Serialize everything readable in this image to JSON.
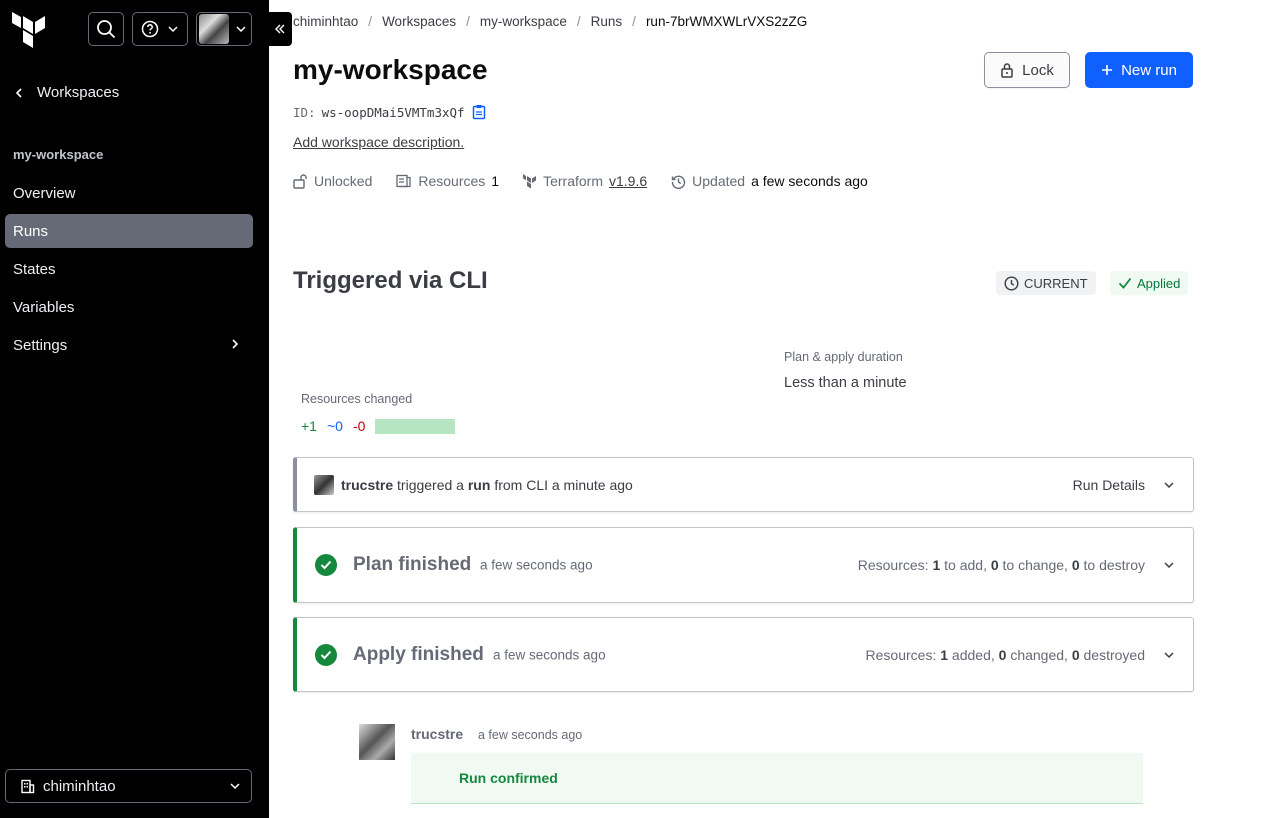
{
  "sidebar": {
    "back_label": "Workspaces",
    "workspace_title": "my-workspace",
    "nav": [
      {
        "label": "Overview"
      },
      {
        "label": "Runs"
      },
      {
        "label": "States"
      },
      {
        "label": "Variables"
      },
      {
        "label": "Settings"
      }
    ],
    "org_name": "chiminhtao"
  },
  "breadcrumb": [
    "chiminhtao",
    "Workspaces",
    "my-workspace",
    "Runs",
    "run-7brWMXWLrVXS2zZG"
  ],
  "header": {
    "title": "my-workspace",
    "lock_label": "Lock",
    "new_run_label": "New run",
    "id_label": "ID:",
    "id_value": "ws-oopDMai5VMTm3xQf",
    "add_description": "Add workspace description."
  },
  "meta": {
    "lock_status": "Unlocked",
    "resources_label": "Resources",
    "resources_count": "1",
    "terraform_label": "Terraform",
    "terraform_version": "v1.9.6",
    "updated_label": "Updated",
    "updated_value": "a few seconds ago"
  },
  "run": {
    "title": "Triggered via CLI",
    "badge_current": "CURRENT",
    "badge_applied": "Applied",
    "duration_label": "Plan & apply duration",
    "duration_value": "Less than a minute",
    "resources_changed_label": "Resources changed",
    "added": "+1",
    "changed": "~0",
    "destroyed": "-0"
  },
  "trigger": {
    "user": "trucstre",
    "text1": "triggered a",
    "run_word": "run",
    "text2": "from CLI a minute ago",
    "details_label": "Run Details"
  },
  "plan": {
    "title": "Plan finished",
    "time": "a few seconds ago",
    "res_prefix": "Resources:",
    "add": "1",
    "add_label": "to add,",
    "change": "0",
    "change_label": "to change,",
    "destroy": "0",
    "destroy_label": "to destroy"
  },
  "apply": {
    "title": "Apply finished",
    "time": "a few seconds ago",
    "res_prefix": "Resources:",
    "added": "1",
    "added_label": "added,",
    "changed": "0",
    "changed_label": "changed,",
    "destroyed": "0",
    "destroyed_label": "destroyed"
  },
  "comment": {
    "user": "trucstre",
    "time": "a few seconds ago",
    "message": "Run confirmed"
  },
  "colors": {
    "primary": "#1060ff",
    "success": "#15883e",
    "sidebar_bg": "#000000"
  }
}
